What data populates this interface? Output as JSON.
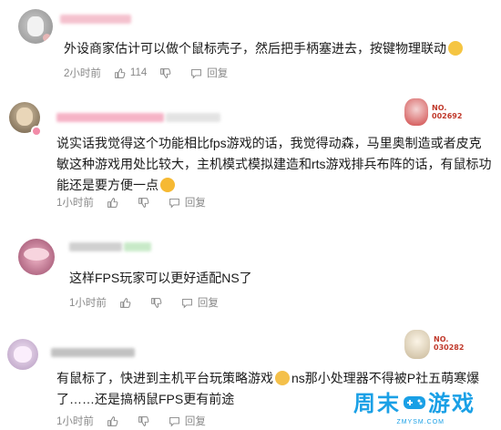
{
  "comments": [
    {
      "text_lines": [
        "外设商家估计可以做个鼠标壳子，然后把手柄塞进去，按键物理联动"
      ],
      "time": "2小时前",
      "likes": "114",
      "reply_label": "回复"
    },
    {
      "badge_no": "NO.\n002692",
      "text_lines": [
        "说实话我觉得这个功能相比fps游戏的话，我觉得动森，马里奥制造或者皮克",
        "敏这种游戏用处比较大，主机模式模拟建造和rts游戏排兵布阵的话，有鼠标功",
        "能还是要方便一点"
      ],
      "time": "1小时前",
      "likes": "",
      "reply_label": "回复"
    },
    {
      "text_lines": [
        "这样FPS玩家可以更好适配NS了"
      ],
      "time": "1小时前",
      "likes": "",
      "reply_label": "回复"
    },
    {
      "badge_no": "NO.\n030282",
      "text_lines": [
        "有鼠标了，快进到主机平台玩策略游戏",
        "ns那小处理器不得被P社五萌寒爆",
        "了……还是搞柄鼠FPS更有前途"
      ],
      "time": "1小时前",
      "likes": "",
      "reply_label": "回复"
    }
  ],
  "watermark": {
    "text_a": "周末",
    "text_b": "游戏",
    "sub": "ZMYSM.COM"
  },
  "colors": {
    "text": "#1a1a1a",
    "meta": "#888888",
    "badge": "#c0392b",
    "watermark": "#1aa0e6"
  }
}
